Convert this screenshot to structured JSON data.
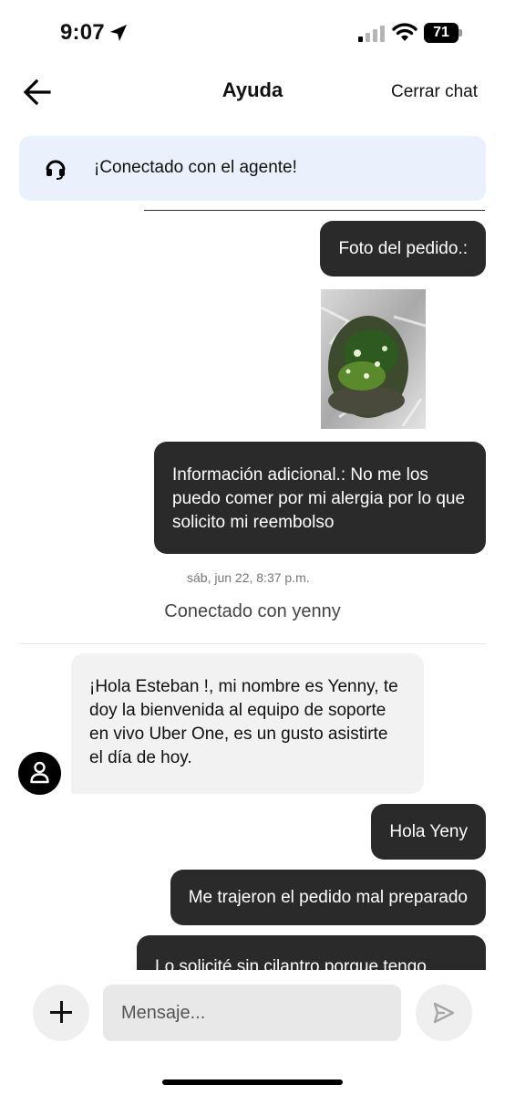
{
  "status_bar": {
    "time": "9:07",
    "battery": "71"
  },
  "header": {
    "title": "Ayuda",
    "close_label": "Cerrar chat"
  },
  "banner": {
    "text": "¡Conectado con el agente!"
  },
  "messages": [
    {
      "from": "user",
      "text": "Foto del pedido.:"
    },
    {
      "from": "user",
      "text": "Información adicional.: No me los puedo comer por mi alergia por lo que solicito mi reembolso"
    },
    {
      "from": "agent",
      "text": "¡Hola Esteban !, mi nombre es Yenny, te doy la bienvenida al equipo de soporte en vivo Uber One, es un gusto asistirte el día de hoy."
    },
    {
      "from": "user",
      "text": "Hola Yeny"
    },
    {
      "from": "user",
      "text": "Me trajeron el pedido mal preparado"
    },
    {
      "from": "user",
      "text": "Lo solicité sin cilantro porque tengo"
    }
  ],
  "timestamp": "sáb, jun 22, 8:37 p.m.",
  "connected_agent": "Conectado con yenny",
  "composer": {
    "placeholder": "Mensaje..."
  },
  "colors": {
    "banner_bg": "#eaf1fc",
    "outgoing_bubble": "#2a2a2a",
    "incoming_bubble": "#f2f2f2"
  },
  "icons": {
    "back": "arrow-left-icon",
    "agent": "headset-icon",
    "avatar": "person-icon",
    "attach": "plus-icon",
    "send": "send-icon"
  }
}
